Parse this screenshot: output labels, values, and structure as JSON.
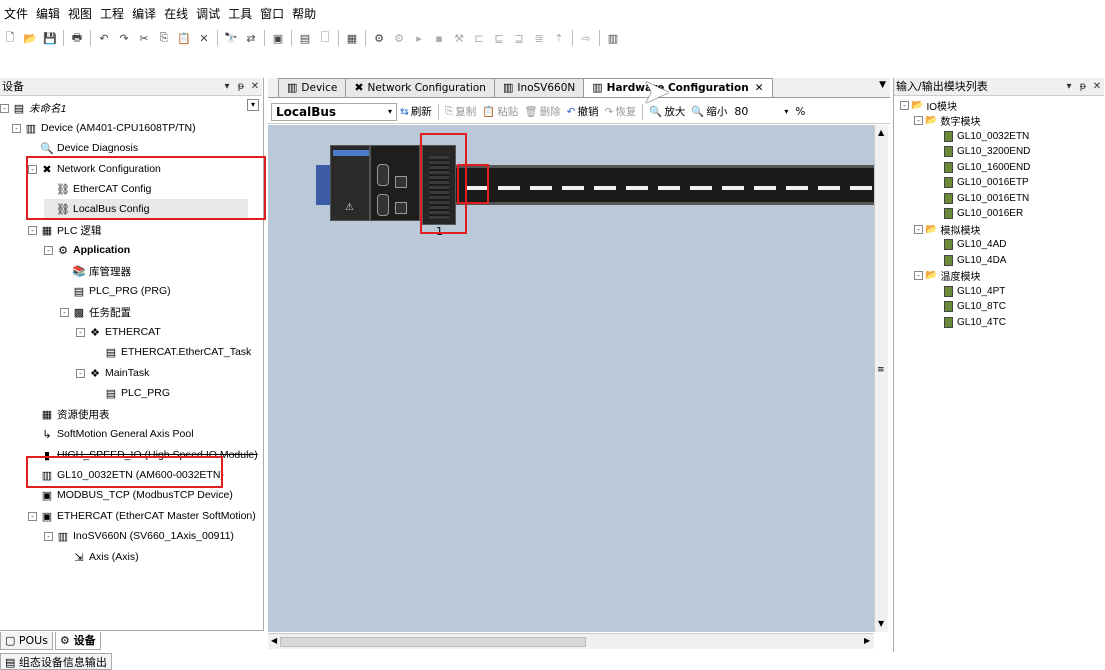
{
  "menu": [
    "文件",
    "编辑",
    "视图",
    "工程",
    "编译",
    "在线",
    "调试",
    "工具",
    "窗口",
    "帮助"
  ],
  "left_panel": {
    "title": "设备",
    "tree": [
      {
        "label": "未命名1",
        "icon": "project-icon",
        "exp": "-",
        "italic": true
      },
      {
        "label": "Device (AM401-CPU1608TP/TN)",
        "icon": "device-icon",
        "exp": "-"
      },
      {
        "label": "Device Diagnosis",
        "icon": "diagnosis-icon",
        "exp": ""
      },
      {
        "label": "Network Configuration",
        "icon": "network-icon",
        "exp": "-"
      },
      {
        "label": "EtherCAT Config",
        "icon": "ethercat-icon",
        "exp": ""
      },
      {
        "label": "LocalBus Config",
        "icon": "localbus-icon",
        "exp": "",
        "selected": true
      },
      {
        "label": "PLC 逻辑",
        "icon": "plc-icon",
        "exp": "-"
      },
      {
        "label": "Application",
        "icon": "application-icon",
        "exp": "-",
        "bold": true
      },
      {
        "label": "库管理器",
        "icon": "library-icon",
        "exp": ""
      },
      {
        "label": "PLC_PRG (PRG)",
        "icon": "program-icon",
        "exp": ""
      },
      {
        "label": "任务配置",
        "icon": "task-config-icon",
        "exp": "-"
      },
      {
        "label": "ETHERCAT",
        "icon": "task-icon",
        "exp": "-"
      },
      {
        "label": "ETHERCAT.EtherCAT_Task",
        "icon": "program-icon",
        "exp": ""
      },
      {
        "label": "MainTask",
        "icon": "task-icon",
        "exp": "-"
      },
      {
        "label": "PLC_PRG",
        "icon": "program-icon",
        "exp": ""
      },
      {
        "label": "资源使用表",
        "icon": "table-icon",
        "exp": ""
      },
      {
        "label": "SoftMotion General Axis Pool",
        "icon": "axis-pool-icon",
        "exp": ""
      },
      {
        "label": "HIGH_SPEED_IO (High Speed IO Module)",
        "icon": "io-icon",
        "exp": "",
        "strike": true
      },
      {
        "label": "GL10_0032ETN (AM600-0032ETN)",
        "icon": "module-icon",
        "exp": ""
      },
      {
        "label": "MODBUS_TCP (ModbusTCP Device)",
        "icon": "modbus-icon",
        "exp": ""
      },
      {
        "label": "ETHERCAT (EtherCAT Master SoftMotion)",
        "icon": "ethercat-master-icon",
        "exp": "-"
      },
      {
        "label": "InoSV660N (SV660_1Axis_00911)",
        "icon": "servo-icon",
        "exp": "-"
      },
      {
        "label": "Axis (Axis)",
        "icon": "axis-icon",
        "exp": ""
      }
    ],
    "bottom_tabs": [
      "POUs",
      "设备"
    ],
    "output_tab": "组态设备信息输出"
  },
  "doc_tabs": [
    {
      "label": "Device",
      "icon": "device-icon"
    },
    {
      "label": "Network Configuration",
      "icon": "network-icon"
    },
    {
      "label": "InoSV660N",
      "icon": "servo-icon"
    },
    {
      "label": "Hardware Configuration",
      "icon": "hardware-icon",
      "active": true
    }
  ],
  "editor_toolbar": {
    "bus_select": "LocalBus",
    "refresh": "刷新",
    "copy": "复制",
    "paste": "粘贴",
    "delete": "删除",
    "undo": "撤销",
    "redo": "恢复",
    "zoom_in": "放大",
    "zoom_out": "缩小",
    "zoom_value": "80",
    "zoom_unit": "%"
  },
  "canvas": {
    "slot_number": "1"
  },
  "right_panel": {
    "title": "输入/输出模块列表",
    "root": "IO模块",
    "groups": [
      {
        "name": "数字模块",
        "items": [
          "GL10_0032ETN",
          "GL10_3200END",
          "GL10_1600END",
          "GL10_0016ETP",
          "GL10_0016ETN",
          "GL10_0016ER"
        ]
      },
      {
        "name": "模拟模块",
        "items": [
          "GL10_4AD",
          "GL10_4DA"
        ]
      },
      {
        "name": "温度模块",
        "items": [
          "GL10_4PT",
          "GL10_8TC",
          "GL10_4TC"
        ]
      }
    ]
  },
  "colors": {
    "canvas_bg": "#b9c9d8",
    "highlight": "#e02020",
    "rail": "#1b1b1b"
  }
}
